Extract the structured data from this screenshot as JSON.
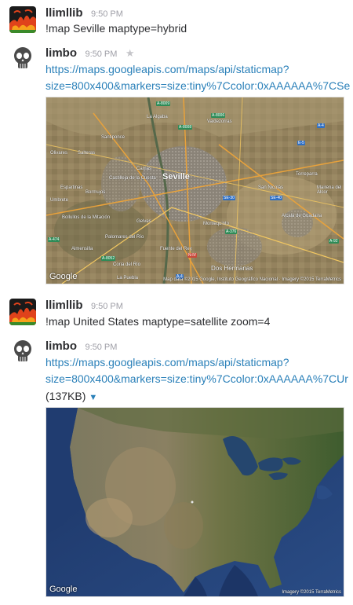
{
  "messages": [
    {
      "user": "llimllib",
      "time": "9:50 PM",
      "text": "!map Seville maptype=hybrid"
    },
    {
      "user": "limbo",
      "time": "9:50 PM",
      "link_line1": "https://maps.googleapis.com/maps/api/staticmap?",
      "link_line2": "size=800x400&markers=size:tiny%7Ccolor:0xAAAAAA%7CSe"
    },
    {
      "user": "llimllib",
      "time": "9:50 PM",
      "text": "!map United States maptype=satellite zoom=4"
    },
    {
      "user": "limbo",
      "time": "9:50 PM",
      "link_line1": "https://maps.googleapis.com/maps/api/staticmap?",
      "link_line2": "size=800x400&markers=size:tiny%7Ccolor:0xAAAAAA%7CUr",
      "size_text": "(137KB)"
    }
  ],
  "seville_map": {
    "google_label": "Google",
    "credits": "Map data ©2015 Google, Instituto Geográfico Nacional · Imagery ©2015 TerraMetrics",
    "places": [
      "Seville",
      "Valdezorras",
      "La Algaba",
      "Santiponce",
      "Salteras",
      "Olivares",
      "Camas",
      "Castilleja de la Cuesta",
      "Bormujos",
      "Espartinas",
      "Umbrete",
      "Bollullos de la Mitación",
      "Palomares del Río",
      "Almensilla",
      "Coria del Río",
      "Gelves",
      "La Puebla",
      "Montequinto",
      "Dos Hermanas",
      "Fuente del Rey",
      "San Nicolás",
      "Alcalá de Guadaira",
      "Torreparra",
      "Mairena del Alcor",
      "San José de la Rinconada",
      "Mairena del Aljarafe",
      "Tomares"
    ],
    "roads": [
      "A-8009",
      "A-8006",
      "A-4",
      "E-5",
      "A-8008",
      "A-66",
      "SE-30",
      "A-49",
      "SE-40",
      "A-376",
      "A-474",
      "A-8052",
      "N-IV",
      "A-92",
      "E-1"
    ]
  },
  "us_map": {
    "google_label": "Google",
    "credits": "Imagery ©2015 TerraMetrics"
  }
}
